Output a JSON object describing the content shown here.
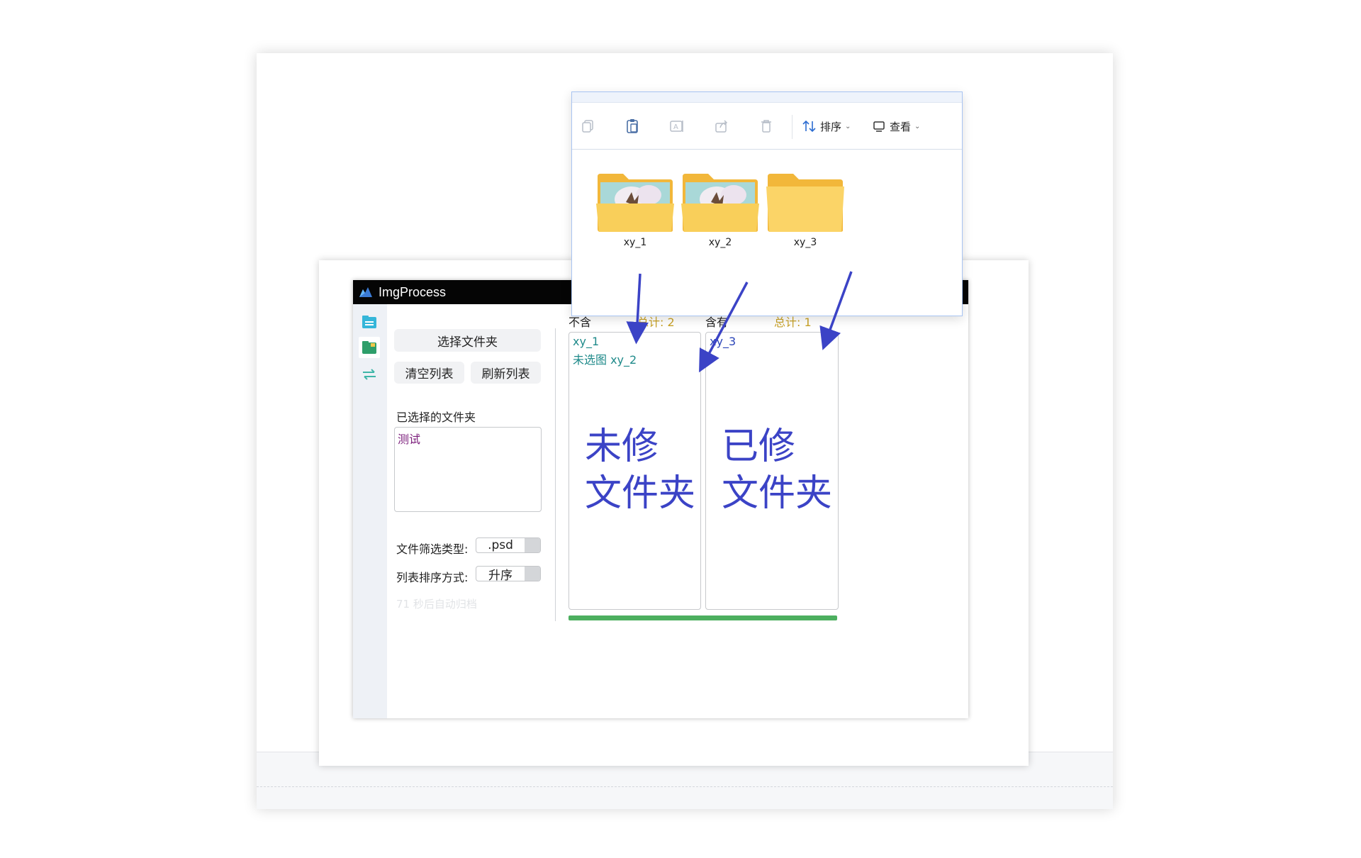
{
  "app": {
    "title": "ImgProcess",
    "buttons": {
      "select_folder": "选择文件夹",
      "clear_list": "清空列表",
      "refresh_list": "刷新列表"
    },
    "selected_folders_label": "已选择的文件夹",
    "selected_folders": [
      "测试"
    ],
    "filter_label": "文件筛选类型:",
    "filter_value": ".psd",
    "sort_label": "列表排序方式:",
    "sort_value": "升序",
    "auto_archive_text": "71 秒后自动归档",
    "left_column": {
      "title": "不含",
      "count_text": "总计: 2",
      "items": [
        "xy_1",
        "未选图 xy_2"
      ]
    },
    "right_column": {
      "title": "含有",
      "count_text": "总计: 1",
      "items": [
        "xy_3"
      ]
    },
    "progress": 1.0
  },
  "annotations": {
    "left_note_line1": "未修",
    "left_note_line2": "文件夹",
    "right_note_line1": "已修",
    "right_note_line2": "文件夹"
  },
  "explorer": {
    "toolbar": {
      "sort_label": "排序",
      "view_label": "查看",
      "icons": [
        "copy-icon",
        "paste-icon",
        "rename-icon",
        "share-icon",
        "delete-icon"
      ]
    },
    "folders": [
      {
        "name": "xy_1",
        "has_preview": true
      },
      {
        "name": "xy_2",
        "has_preview": true
      },
      {
        "name": "xy_3",
        "has_preview": false
      }
    ]
  },
  "colors": {
    "accent_arrow": "#3b43c6",
    "progress": "#4caf5f",
    "count_text": "#c9a227",
    "list_item_teal": "#1f8a8a",
    "list_item_blue": "#2b45b8",
    "selected_folder": "#7a1b7a"
  }
}
